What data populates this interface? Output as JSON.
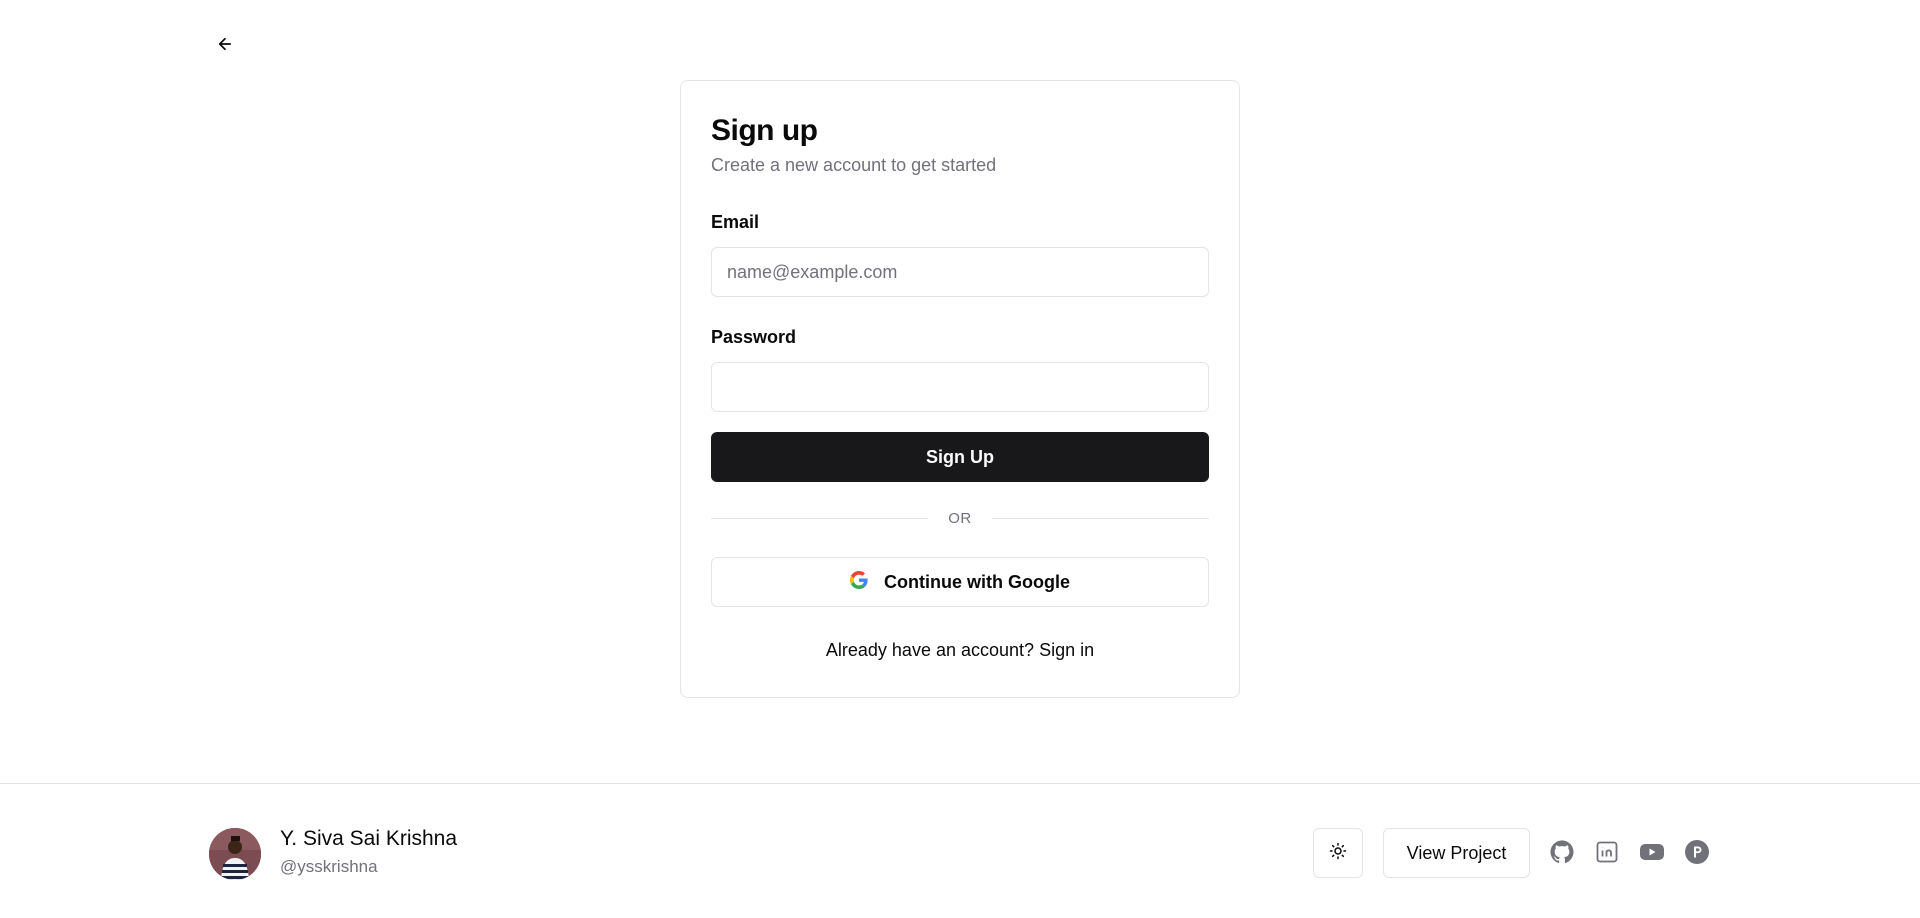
{
  "header": {
    "back_icon": "arrow-left-icon"
  },
  "signup": {
    "title": "Sign up",
    "subtitle": "Create a new account to get started",
    "email_label": "Email",
    "email_placeholder": "name@example.com",
    "email_value": "",
    "password_label": "Password",
    "password_value": "",
    "submit_label": "Sign Up",
    "divider_text": "OR",
    "google_label": "Continue with Google",
    "google_icon": "google-icon",
    "already_text": "Already have an account?",
    "signin_link": "Sign in"
  },
  "footer": {
    "author_name": "Y. Siva Sai Krishna",
    "author_handle": "@ysskrishna",
    "theme_icon": "sun-icon",
    "view_project_label": "View Project",
    "socials": [
      "github-icon",
      "linkedin-icon",
      "youtube-icon",
      "producthunt-icon"
    ]
  },
  "colors": {
    "primary": "#18181b",
    "muted_text": "#71717a",
    "border": "#e4e4e7",
    "social_icon": "#71717a"
  }
}
